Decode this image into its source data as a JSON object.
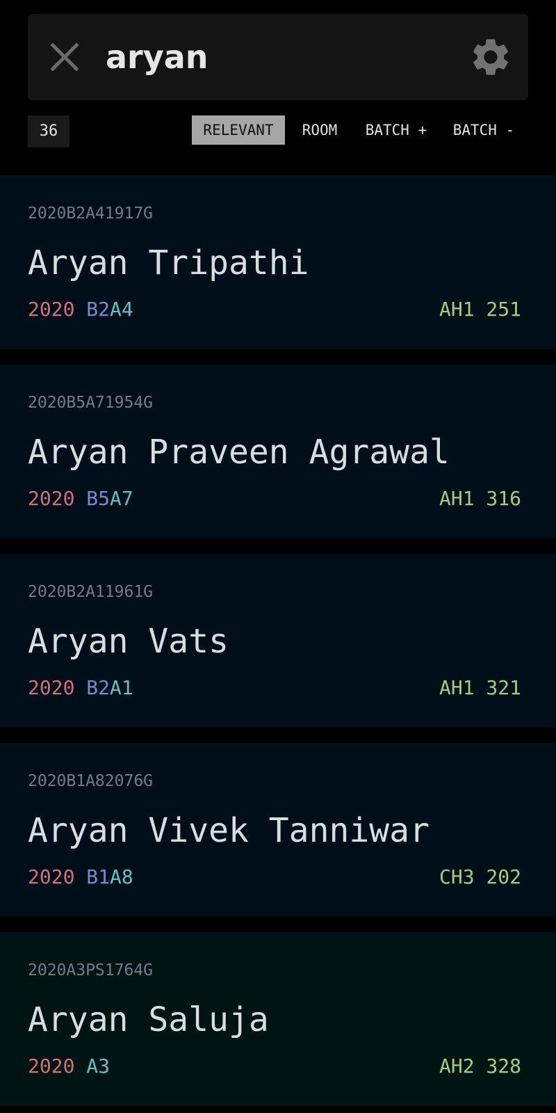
{
  "search": {
    "query": "aryan",
    "clear_icon": "close-icon",
    "settings_icon": "gear-icon"
  },
  "results_count": "36",
  "sort_options": [
    {
      "label": "RELEVANT",
      "active": true
    },
    {
      "label": "ROOM",
      "active": false
    },
    {
      "label": "BATCH +",
      "active": false
    },
    {
      "label": "BATCH -",
      "active": false
    }
  ],
  "students": [
    {
      "id": "2020B2A41917G",
      "name": "Aryan Tripathi",
      "year": "2020",
      "b": "B2",
      "a": "A4",
      "hostel": "AH1",
      "room": "251"
    },
    {
      "id": "2020B5A71954G",
      "name": "Aryan Praveen Agrawal",
      "year": "2020",
      "b": "B5",
      "a": "A7",
      "hostel": "AH1",
      "room": "316"
    },
    {
      "id": "2020B2A11961G",
      "name": "Aryan Vats",
      "year": "2020",
      "b": "B2",
      "a": "A1",
      "hostel": "AH1",
      "room": "321"
    },
    {
      "id": "2020B1A82076G",
      "name": "Aryan Vivek Tanniwar",
      "year": "2020",
      "b": "B1",
      "a": "A8",
      "hostel": "CH3",
      "room": "202"
    },
    {
      "id": "2020A3PS1764G",
      "name": "Aryan Saluja",
      "year": "2020",
      "b": "",
      "a": "A3",
      "hostel": "AH2",
      "room": "328"
    }
  ],
  "colors": {
    "background": "#000000",
    "card": "#000e1a",
    "card_alt": "#001414",
    "year": "#d4707a",
    "b_code": "#6f8fd0",
    "a_code": "#5cc2c2",
    "room": "#a2d07a",
    "active_sort": "#a6a6a6"
  }
}
